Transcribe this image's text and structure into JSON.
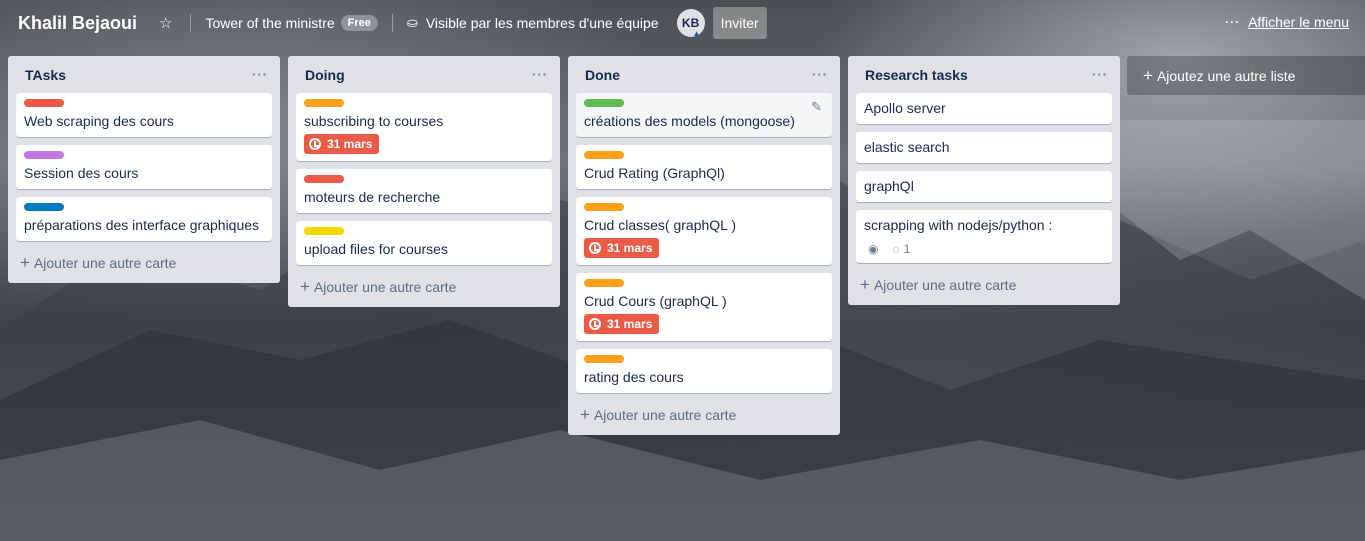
{
  "header": {
    "board_title": "Khalil Bejaoui",
    "team_name": "Tower of the ministre",
    "plan_badge": "Free",
    "visibility": "Visible par les membres d'une équipe",
    "avatar_initials": "KB",
    "invite_label": "Inviter",
    "menu_label": "Afficher le menu"
  },
  "colors": {
    "red": "#eb5a46",
    "orange": "#ff9f1a",
    "purple": "#c377e0",
    "blue": "#0079bf",
    "green": "#61bd4f",
    "yellow": "#f2d600"
  },
  "add_card_label": "Ajouter une autre carte",
  "add_list_label": "Ajoutez une autre liste",
  "lists": [
    {
      "title": "TAsks",
      "cards": [
        {
          "label_color": "red",
          "text": "Web scraping des cours"
        },
        {
          "label_color": "purple",
          "text": "Session des cours"
        },
        {
          "label_color": "blue",
          "text": "préparations des interface graphiques"
        }
      ]
    },
    {
      "title": "Doing",
      "cards": [
        {
          "label_color": "orange",
          "text": "subscribing to courses",
          "due": "31 mars"
        },
        {
          "label_color": "red",
          "text": "moteurs de recherche"
        },
        {
          "label_color": "yellow",
          "text": "upload files for courses"
        }
      ]
    },
    {
      "title": "Done",
      "cards": [
        {
          "label_color": "green",
          "text": "créations des models (mongoose)"
        },
        {
          "label_color": "orange",
          "text": "Crud Rating (GraphQl)"
        },
        {
          "label_color": "orange",
          "text": "Crud classes( graphQL )",
          "due": "31 mars"
        },
        {
          "label_color": "orange",
          "text": "Crud Cours (graphQL )",
          "due": "31 mars"
        },
        {
          "label_color": "orange",
          "text": "rating des cours"
        }
      ]
    },
    {
      "title": "Research tasks",
      "cards": [
        {
          "text": "Apollo server"
        },
        {
          "text": "elastic search"
        },
        {
          "text": "graphQl"
        },
        {
          "text": "scrapping with nodejs/python :",
          "comment_count": "1"
        }
      ]
    }
  ]
}
